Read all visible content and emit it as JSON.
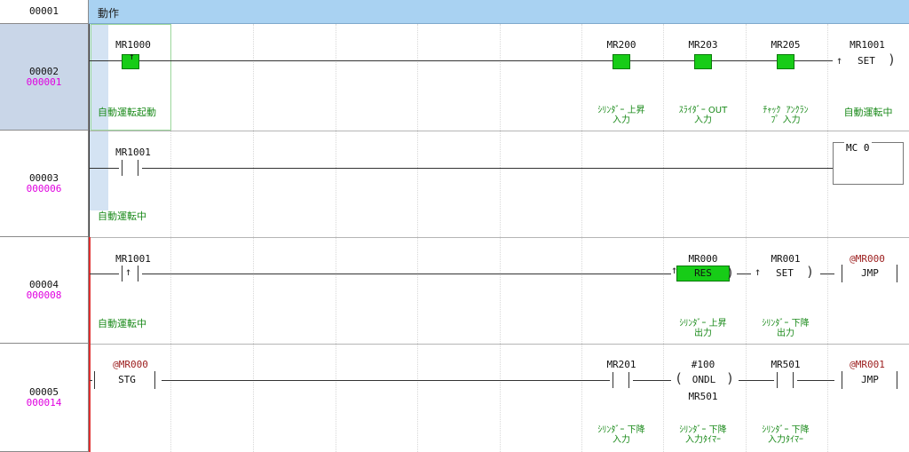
{
  "lines": [
    {
      "num": "00001",
      "step": ""
    },
    {
      "num": "00002",
      "step": "000001"
    },
    {
      "num": "00003",
      "step": "000006"
    },
    {
      "num": "00004",
      "step": "000008"
    },
    {
      "num": "00005",
      "step": "000014"
    }
  ],
  "header": {
    "label": "動作"
  },
  "rung2": {
    "contact1": {
      "device": "MR1000",
      "comment": "自動運転起動"
    },
    "contact2": {
      "device": "MR200",
      "comment": "ｼﾘﾝﾀﾞｰ 上昇\n入力"
    },
    "contact3": {
      "device": "MR203",
      "comment": "ｽﾗｲﾀﾞｰ OUT\n入力"
    },
    "contact4": {
      "device": "MR205",
      "comment": "ﾁｬｯｸ  ｱﾝｸﾗﾝ\nﾌﾟ 入力"
    },
    "coil": {
      "device": "MR1001",
      "instr": "SET",
      "comment": "自動運転中"
    }
  },
  "rung3": {
    "contact1": {
      "device": "MR1001",
      "comment": "自動運転中"
    },
    "coil": {
      "instr": "MC 0"
    }
  },
  "rung4": {
    "contact1": {
      "device": "MR1001",
      "comment": "自動運転中"
    },
    "coil1": {
      "device": "MR000",
      "instr": "RES",
      "comment": "ｼﾘﾝﾀﾞｰ 上昇\n出力"
    },
    "coil2": {
      "device": "MR001",
      "instr": "SET",
      "comment": "ｼﾘﾝﾀﾞｰ 下降\n出力"
    },
    "coil3": {
      "device": "@MR000",
      "instr": "JMP"
    }
  },
  "rung5": {
    "stg": {
      "device": "@MR000",
      "instr": "STG"
    },
    "contact1": {
      "device": "MR201",
      "comment": "ｼﾘﾝﾀﾞｰ 下降\n入力"
    },
    "timer": {
      "preset": "#100",
      "instr": "ONDL",
      "device": "MR501",
      "comment": "ｼﾘﾝﾀﾞｰ 下降\n入力ﾀｲﾏｰ"
    },
    "contact2": {
      "device": "MR501",
      "comment": "ｼﾘﾝﾀﾞｰ 下降\n入力ﾀｲﾏｰ"
    },
    "coil": {
      "device": "@MR001",
      "instr": "JMP"
    }
  }
}
